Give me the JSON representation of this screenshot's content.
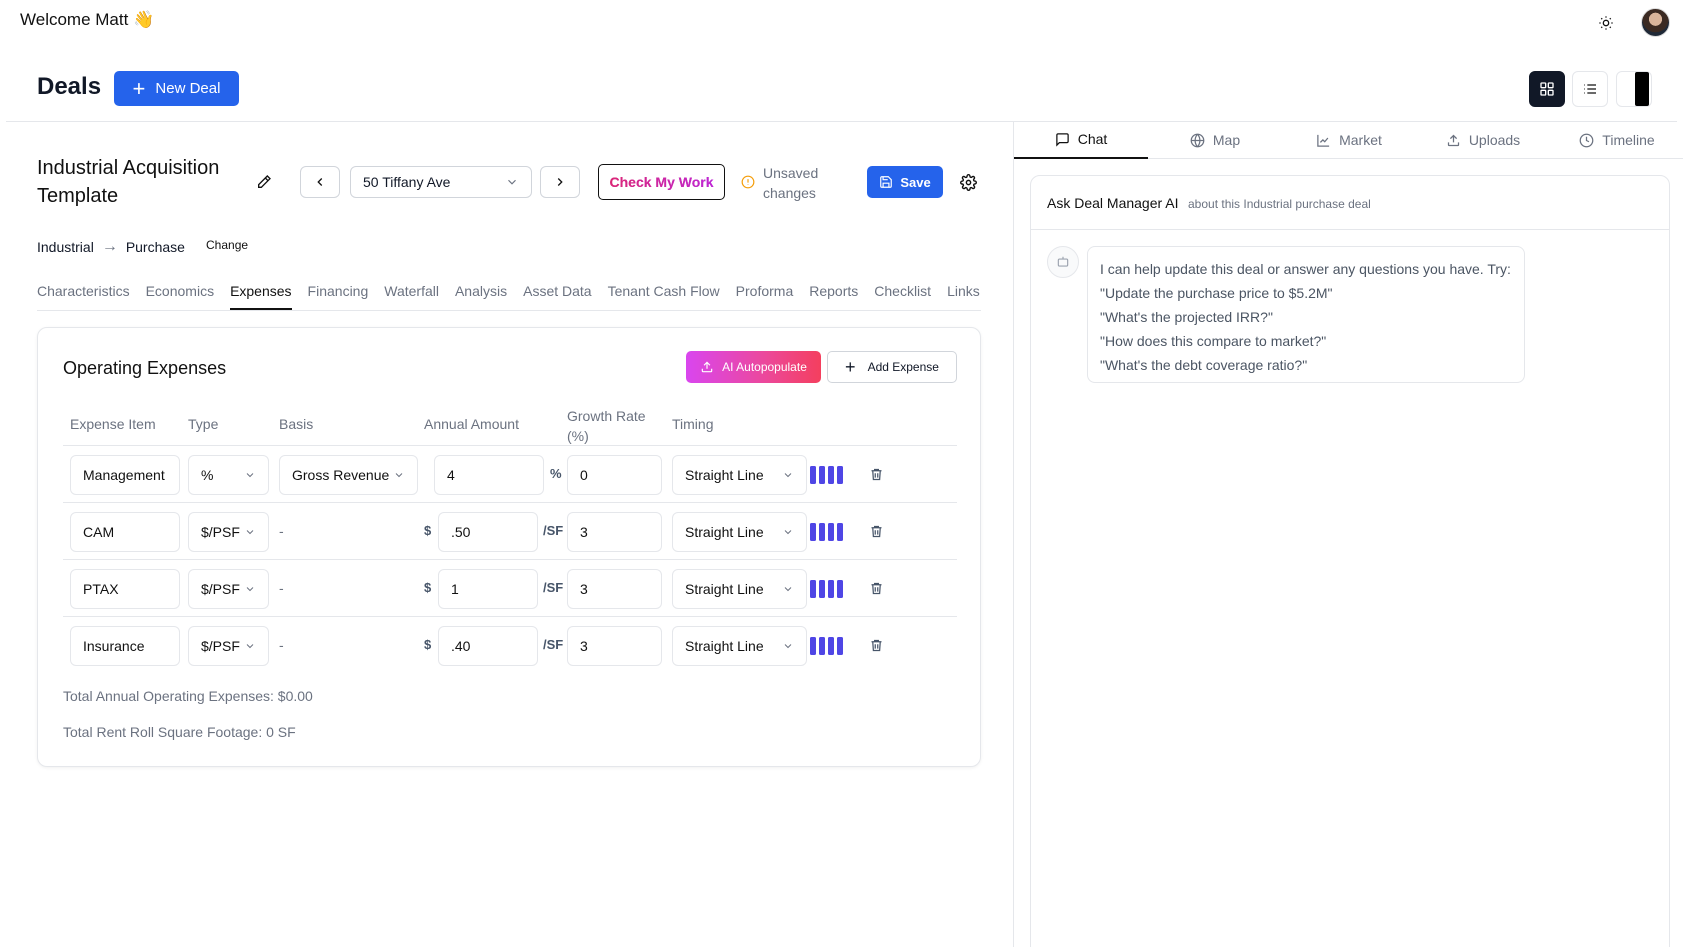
{
  "header": {
    "welcome": "Welcome Matt 👋",
    "page_title": "Deals",
    "new_deal_label": "New Deal"
  },
  "deal": {
    "template_title": "Industrial Acquisition Template",
    "selected_property": "50 Tiffany Ave",
    "check_work_label": "Check My Work",
    "unsaved_label": "Unsaved changes",
    "save_label": "Save",
    "breadcrumb": {
      "type": "Industrial",
      "subtype": "Purchase",
      "change_label": "Change"
    }
  },
  "tabs": [
    {
      "label": "Characteristics",
      "active": false
    },
    {
      "label": "Economics",
      "active": false
    },
    {
      "label": "Expenses",
      "active": true
    },
    {
      "label": "Financing",
      "active": false
    },
    {
      "label": "Waterfall",
      "active": false
    },
    {
      "label": "Analysis",
      "active": false
    },
    {
      "label": "Asset Data",
      "active": false
    },
    {
      "label": "Tenant Cash Flow",
      "active": false
    },
    {
      "label": "Proforma",
      "active": false
    },
    {
      "label": "Reports",
      "active": false
    },
    {
      "label": "Checklist",
      "active": false
    },
    {
      "label": "Links",
      "active": false
    }
  ],
  "expenses": {
    "title": "Operating Expenses",
    "ai_label": "AI Autopopulate",
    "add_label": "Add Expense",
    "columns": [
      "Expense Item",
      "Type",
      "Basis",
      "Annual Amount",
      "Growth Rate (%)",
      "Timing"
    ],
    "rows": [
      {
        "item": "Management",
        "type": "%",
        "basis": "Gross Revenue",
        "prefix": "",
        "amount": "4",
        "suffix": "%",
        "growth": "0",
        "timing": "Straight Line"
      },
      {
        "item": "CAM",
        "type": "$/PSF",
        "basis": "-",
        "prefix": "$",
        "amount": ".50",
        "suffix": "/SF",
        "growth": "3",
        "timing": "Straight Line"
      },
      {
        "item": "PTAX",
        "type": "$/PSF",
        "basis": "-",
        "prefix": "$",
        "amount": "1",
        "suffix": "/SF",
        "growth": "3",
        "timing": "Straight Line"
      },
      {
        "item": "Insurance",
        "type": "$/PSF",
        "basis": "-",
        "prefix": "$",
        "amount": ".40",
        "suffix": "/SF",
        "growth": "3",
        "timing": "Straight Line"
      }
    ],
    "total_expenses": "Total Annual Operating Expenses: $0.00",
    "total_sf": "Total Rent Roll Square Footage: 0 SF"
  },
  "right_tabs": [
    {
      "label": "Chat",
      "icon": "chat-icon",
      "active": true
    },
    {
      "label": "Map",
      "icon": "globe-icon",
      "active": false
    },
    {
      "label": "Market",
      "icon": "chart-icon",
      "active": false
    },
    {
      "label": "Uploads",
      "icon": "upload-icon",
      "active": false
    },
    {
      "label": "Timeline",
      "icon": "clock-icon",
      "active": false
    }
  ],
  "chat": {
    "title": "Ask Deal Manager AI",
    "subtitle": "about this Industrial purchase deal",
    "intro": "I can help update this deal or answer any questions you have. Try:",
    "suggestions": [
      "\"Update the purchase price to $5.2M\"",
      "\"What's the projected IRR?\"",
      "\"How does this compare to market?\"",
      "\"What's the debt coverage ratio?\""
    ]
  },
  "colors": {
    "accent": "#2563eb",
    "bars": "#4f46e5",
    "ai_gradient_start": "#d946ef",
    "ai_gradient_end": "#f43f5e"
  }
}
